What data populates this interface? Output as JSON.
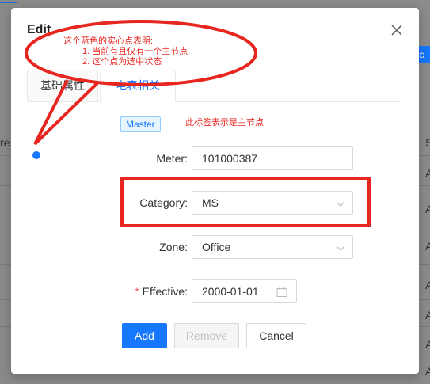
{
  "background": {
    "left_letter": "re",
    "right_letters": [
      "S",
      "A",
      "A",
      "A",
      "A",
      "A",
      "A",
      "A"
    ],
    "right_button_label": "ec"
  },
  "modal": {
    "title": "Edit",
    "close_icon": "close-icon",
    "tabs": [
      {
        "label": "基础属性",
        "active": false
      },
      {
        "label": "电表相关",
        "active": true
      }
    ],
    "master_tag": "Master",
    "fields": {
      "meter": {
        "label": "Meter",
        "value": "101000387"
      },
      "category": {
        "label": "Category",
        "value": "MS"
      },
      "zone": {
        "label": "Zone",
        "value": "Office"
      },
      "effective": {
        "label": "Effective",
        "value": "2000-01-01",
        "required": true
      }
    },
    "buttons": {
      "add": "Add",
      "remove": "Remove",
      "cancel": "Cancel"
    }
  },
  "annotations": {
    "bubble_lines": [
      "这个蓝色的实心点表明:",
      "1. 当前有且仅有一个主节点",
      "2. 这个点为选中状态"
    ],
    "tag_note": "此标签表示是主节点"
  },
  "colors": {
    "primary": "#1677ff",
    "annotation_red": "#e6261f",
    "dot_blue": "#1677ff"
  }
}
